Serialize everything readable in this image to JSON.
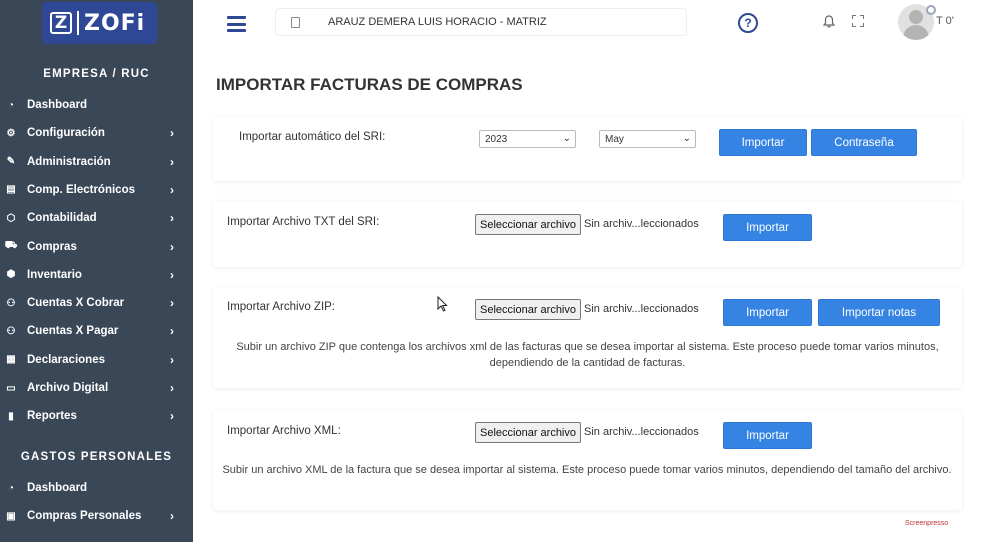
{
  "brand": {
    "logo_mark": "Z",
    "logo_text": "ZOFi"
  },
  "sidebar": {
    "section1_title": "EMPRESA / RUC",
    "items": [
      {
        "label": "Dashboard",
        "icon": "dashboard-icon",
        "has_chevron": false
      },
      {
        "label": "Configuración",
        "icon": "gear-icon",
        "has_chevron": true
      },
      {
        "label": "Administración",
        "icon": "pencil-icon",
        "has_chevron": true
      },
      {
        "label": "Comp. Electrónicos",
        "icon": "document-icon",
        "has_chevron": true
      },
      {
        "label": "Contabilidad",
        "icon": "shield-icon",
        "has_chevron": true
      },
      {
        "label": "Compras",
        "icon": "cart-icon",
        "has_chevron": true
      },
      {
        "label": "Inventario",
        "icon": "box-icon",
        "has_chevron": true
      },
      {
        "label": "Cuentas X Cobrar",
        "icon": "user-plus-icon",
        "has_chevron": true
      },
      {
        "label": "Cuentas X Pagar",
        "icon": "user-minus-icon",
        "has_chevron": true
      },
      {
        "label": "Declaraciones",
        "icon": "file-icon",
        "has_chevron": true
      },
      {
        "label": "Archivo Digital",
        "icon": "folder-icon",
        "has_chevron": true
      },
      {
        "label": "Reportes",
        "icon": "bar-chart-icon",
        "has_chevron": true
      }
    ],
    "section2_title": "GASTOS PERSONALES",
    "items2": [
      {
        "label": "Dashboard",
        "icon": "dashboard-icon",
        "has_chevron": false
      },
      {
        "label": "Compras Personales",
        "icon": "wallet-icon",
        "has_chevron": true
      }
    ],
    "chevron_glyph": "›"
  },
  "header": {
    "company": "ARAUZ DEMERA LUIS HORACIO - MATRIZ",
    "help_glyph": "?",
    "bell_glyph": "🔔",
    "user_initial": "T 0'"
  },
  "main": {
    "title": "IMPORTAR FACTURAS DE COMPRAS",
    "auto": {
      "label": "Importar automático del SRI:",
      "year": "2023",
      "month": "May",
      "import_btn": "Importar",
      "password_btn": "Contraseña"
    },
    "txt": {
      "label": "Importar Archivo TXT del SRI:",
      "file_btn": "Seleccionar archivo",
      "file_status": "Sin archiv...leccionados",
      "import_btn": "Importar"
    },
    "zip": {
      "label": "Importar Archivo ZIP:",
      "file_btn": "Seleccionar archivo",
      "file_status": "Sin archiv...leccionados",
      "import_btn": "Importar",
      "import_notes_btn": "Importar notas",
      "desc": "Subir un archivo ZIP que contenga los archivos xml de las facturas que se desea importar al sistema. Este proceso puede tomar varios minutos, dependiendo de la cantidad de facturas."
    },
    "xml": {
      "label": "Importar Archivo XML:",
      "file_btn": "Seleccionar archivo",
      "file_status": "Sin archiv...leccionados",
      "import_btn": "Importar",
      "desc": "Subir un archivo XML de la factura que se desea importar al sistema. Este proceso puede tomar varios minutos, dependiendo del tamaño del archivo."
    }
  },
  "watermark": "Screenpresso"
}
